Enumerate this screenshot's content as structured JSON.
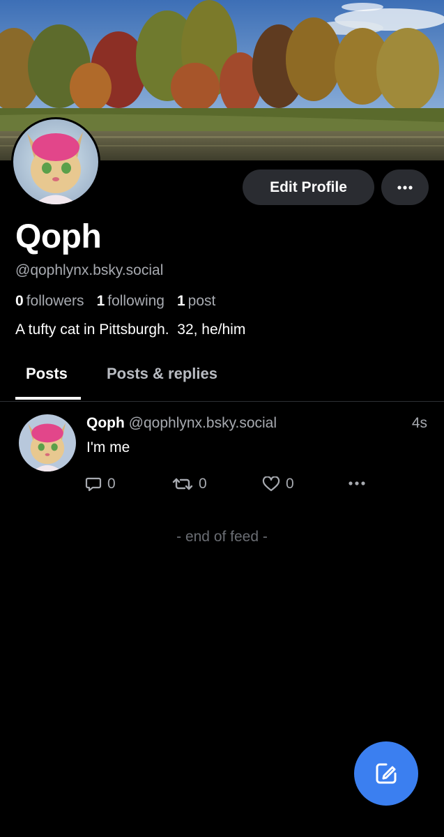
{
  "profile": {
    "display_name": "Qoph",
    "handle": "@qophlynx.bsky.social",
    "bio": "A tufty cat in Pittsburgh.  32, he/him",
    "stats": {
      "followers_count": "0",
      "followers_label": "followers",
      "following_count": "1",
      "following_label": "following",
      "posts_count": "1",
      "posts_label": "post"
    }
  },
  "actions": {
    "edit_profile_label": "Edit Profile",
    "more_icon": "ellipsis-icon"
  },
  "tabs": [
    {
      "label": "Posts",
      "active": true
    },
    {
      "label": "Posts & replies",
      "active": false
    }
  ],
  "feed": {
    "posts": [
      {
        "author_name": "Qoph",
        "author_handle": "@qophlynx.bsky.social",
        "time": "4s",
        "text": "I'm me",
        "reply_count": "0",
        "repost_count": "0",
        "like_count": "0"
      }
    ],
    "end_label": "- end of feed -"
  },
  "fab": {
    "icon": "compose-icon"
  },
  "colors": {
    "background": "#000000",
    "button_bg": "#2a2c31",
    "muted_text": "#a7aab0",
    "accent": "#3b7ff0"
  }
}
